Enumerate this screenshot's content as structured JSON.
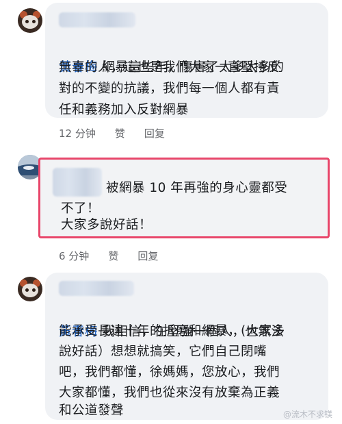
{
  "comments": [
    {
      "author": "黃春梅",
      "line1": " 網暴這些年，傷害了太多太多的",
      "line2": "無辜的人，這也是我們大家一直堅持反",
      "line3": "對的不變的抗議，我們每一個人都有責",
      "line4": "任和義務加入反對網暴",
      "time": "12 分钟",
      "like": "赞",
      "reply": "回复"
    },
    {
      "line1": "被網暴 10 年再強的身心靈都受",
      "line2": "不了！",
      "line3": "大家多說好話！",
      "time": "6 分钟",
      "like": "赞",
      "reply": "回复"
    },
    {
      "author": "黃春梅",
      "line1": " 我相信，在堅強一個人，也無法",
      "line2": "能承受長達十年的折磨和網暴，(大家多",
      "line3": "說好話）想想就搞笑，它們自己閉嘴",
      "line4": "吧，我們都懂，徐媽媽，您放心，我們",
      "line5": "大家都懂，我們也從來沒有放棄為正義",
      "line6": "和公道發聲"
    }
  ],
  "watermark": "@流木不求镁"
}
